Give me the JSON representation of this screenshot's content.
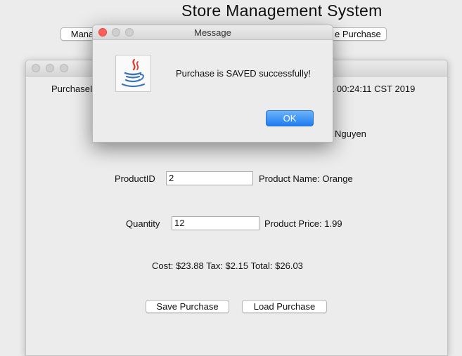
{
  "app": {
    "title": "Store Management System",
    "manage_button_label": "Mana",
    "purchase_button_label": "e Purchase"
  },
  "form": {
    "purchase_id_label": "PurchaseI",
    "date_text": "1 00:24:11 CST 2019",
    "customer_name_text": "Nguyen",
    "product_id_label": "ProductID",
    "product_id_value": "2",
    "product_name_text": "Product Name: Orange",
    "quantity_label": "Quantity",
    "quantity_value": "12",
    "product_price_text": "Product Price: 1.99",
    "cost_summary_text": "Cost: $23.88 Tax: $2.15 Total: $26.03",
    "save_button_label": "Save Purchase",
    "load_button_label": "Load Purchase"
  },
  "dialog": {
    "title": "Message",
    "icon": "java-icon",
    "message": "Purchase is SAVED successfully!",
    "ok_label": "OK"
  },
  "colors": {
    "accent": "#1e7cf1",
    "close_light": "#fc5f57",
    "background": "#ececec"
  }
}
